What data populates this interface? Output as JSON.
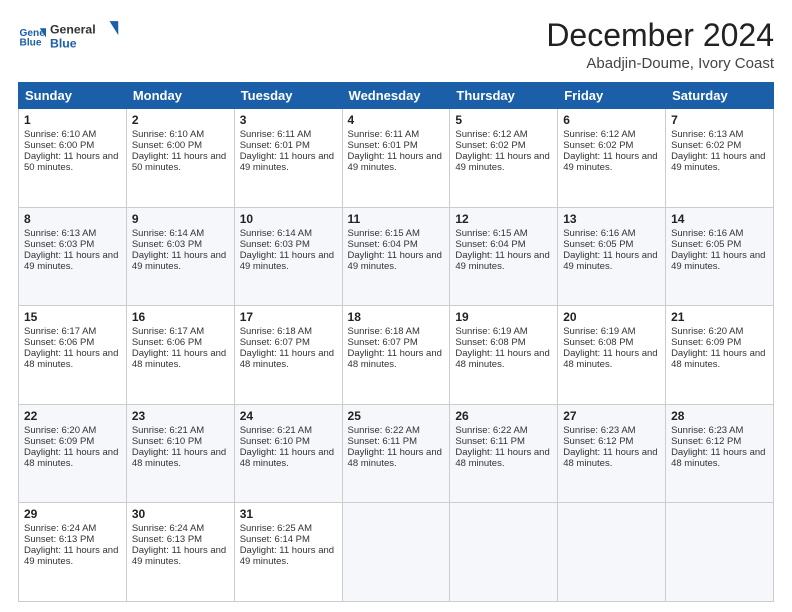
{
  "logo": {
    "line1": "General",
    "line2": "Blue"
  },
  "title": "December 2024",
  "location": "Abadjin-Doume, Ivory Coast",
  "days_of_week": [
    "Sunday",
    "Monday",
    "Tuesday",
    "Wednesday",
    "Thursday",
    "Friday",
    "Saturday"
  ],
  "weeks": [
    [
      {
        "day": "1",
        "sunrise": "6:10 AM",
        "sunset": "6:00 PM",
        "daylight": "11 hours and 50 minutes."
      },
      {
        "day": "2",
        "sunrise": "6:10 AM",
        "sunset": "6:00 PM",
        "daylight": "11 hours and 50 minutes."
      },
      {
        "day": "3",
        "sunrise": "6:11 AM",
        "sunset": "6:01 PM",
        "daylight": "11 hours and 49 minutes."
      },
      {
        "day": "4",
        "sunrise": "6:11 AM",
        "sunset": "6:01 PM",
        "daylight": "11 hours and 49 minutes."
      },
      {
        "day": "5",
        "sunrise": "6:12 AM",
        "sunset": "6:02 PM",
        "daylight": "11 hours and 49 minutes."
      },
      {
        "day": "6",
        "sunrise": "6:12 AM",
        "sunset": "6:02 PM",
        "daylight": "11 hours and 49 minutes."
      },
      {
        "day": "7",
        "sunrise": "6:13 AM",
        "sunset": "6:02 PM",
        "daylight": "11 hours and 49 minutes."
      }
    ],
    [
      {
        "day": "8",
        "sunrise": "6:13 AM",
        "sunset": "6:03 PM",
        "daylight": "11 hours and 49 minutes."
      },
      {
        "day": "9",
        "sunrise": "6:14 AM",
        "sunset": "6:03 PM",
        "daylight": "11 hours and 49 minutes."
      },
      {
        "day": "10",
        "sunrise": "6:14 AM",
        "sunset": "6:03 PM",
        "daylight": "11 hours and 49 minutes."
      },
      {
        "day": "11",
        "sunrise": "6:15 AM",
        "sunset": "6:04 PM",
        "daylight": "11 hours and 49 minutes."
      },
      {
        "day": "12",
        "sunrise": "6:15 AM",
        "sunset": "6:04 PM",
        "daylight": "11 hours and 49 minutes."
      },
      {
        "day": "13",
        "sunrise": "6:16 AM",
        "sunset": "6:05 PM",
        "daylight": "11 hours and 49 minutes."
      },
      {
        "day": "14",
        "sunrise": "6:16 AM",
        "sunset": "6:05 PM",
        "daylight": "11 hours and 49 minutes."
      }
    ],
    [
      {
        "day": "15",
        "sunrise": "6:17 AM",
        "sunset": "6:06 PM",
        "daylight": "11 hours and 48 minutes."
      },
      {
        "day": "16",
        "sunrise": "6:17 AM",
        "sunset": "6:06 PM",
        "daylight": "11 hours and 48 minutes."
      },
      {
        "day": "17",
        "sunrise": "6:18 AM",
        "sunset": "6:07 PM",
        "daylight": "11 hours and 48 minutes."
      },
      {
        "day": "18",
        "sunrise": "6:18 AM",
        "sunset": "6:07 PM",
        "daylight": "11 hours and 48 minutes."
      },
      {
        "day": "19",
        "sunrise": "6:19 AM",
        "sunset": "6:08 PM",
        "daylight": "11 hours and 48 minutes."
      },
      {
        "day": "20",
        "sunrise": "6:19 AM",
        "sunset": "6:08 PM",
        "daylight": "11 hours and 48 minutes."
      },
      {
        "day": "21",
        "sunrise": "6:20 AM",
        "sunset": "6:09 PM",
        "daylight": "11 hours and 48 minutes."
      }
    ],
    [
      {
        "day": "22",
        "sunrise": "6:20 AM",
        "sunset": "6:09 PM",
        "daylight": "11 hours and 48 minutes."
      },
      {
        "day": "23",
        "sunrise": "6:21 AM",
        "sunset": "6:10 PM",
        "daylight": "11 hours and 48 minutes."
      },
      {
        "day": "24",
        "sunrise": "6:21 AM",
        "sunset": "6:10 PM",
        "daylight": "11 hours and 48 minutes."
      },
      {
        "day": "25",
        "sunrise": "6:22 AM",
        "sunset": "6:11 PM",
        "daylight": "11 hours and 48 minutes."
      },
      {
        "day": "26",
        "sunrise": "6:22 AM",
        "sunset": "6:11 PM",
        "daylight": "11 hours and 48 minutes."
      },
      {
        "day": "27",
        "sunrise": "6:23 AM",
        "sunset": "6:12 PM",
        "daylight": "11 hours and 48 minutes."
      },
      {
        "day": "28",
        "sunrise": "6:23 AM",
        "sunset": "6:12 PM",
        "daylight": "11 hours and 48 minutes."
      }
    ],
    [
      {
        "day": "29",
        "sunrise": "6:24 AM",
        "sunset": "6:13 PM",
        "daylight": "11 hours and 49 minutes."
      },
      {
        "day": "30",
        "sunrise": "6:24 AM",
        "sunset": "6:13 PM",
        "daylight": "11 hours and 49 minutes."
      },
      {
        "day": "31",
        "sunrise": "6:25 AM",
        "sunset": "6:14 PM",
        "daylight": "11 hours and 49 minutes."
      },
      null,
      null,
      null,
      null
    ]
  ],
  "cell_labels": {
    "sunrise": "Sunrise:",
    "sunset": "Sunset:",
    "daylight": "Daylight:"
  }
}
